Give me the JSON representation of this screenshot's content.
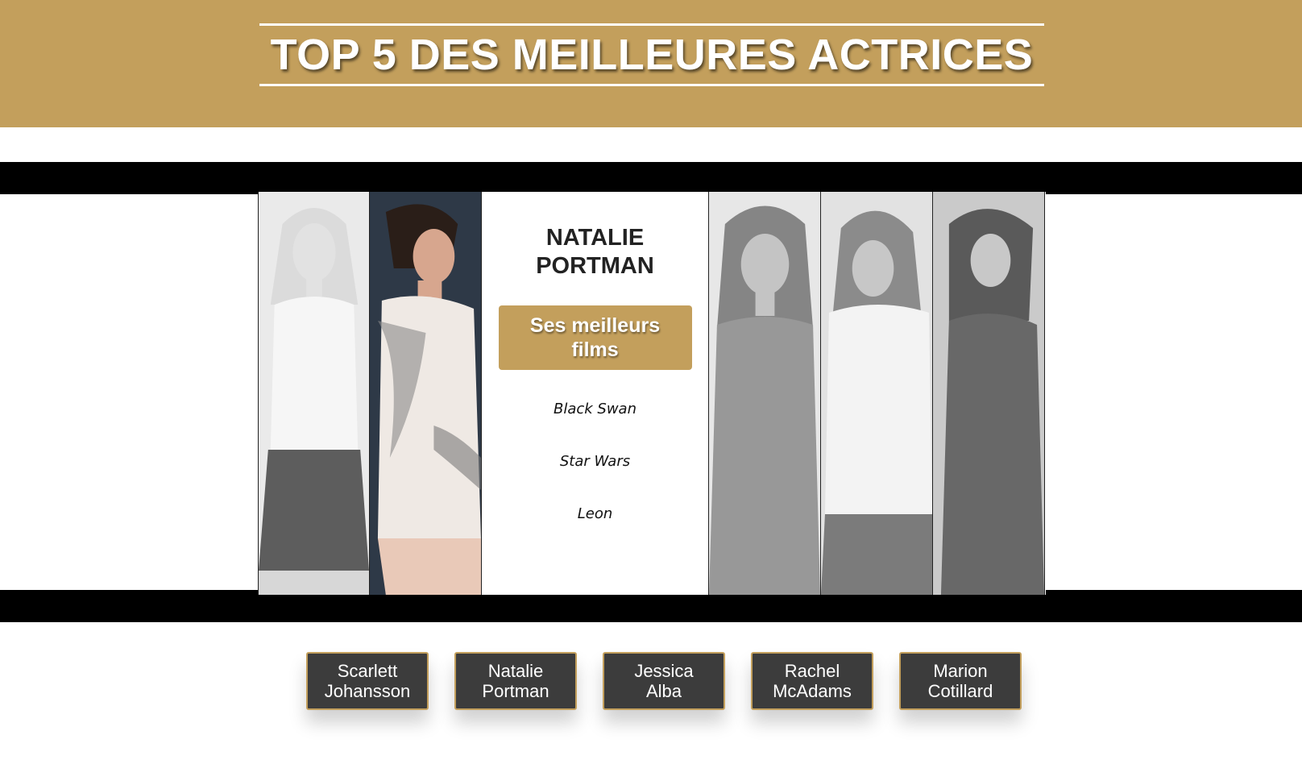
{
  "header": {
    "title": "TOP 5 DES MEILLEURES ACTRICES"
  },
  "colors": {
    "accent": "#c39f5c",
    "band": "#000000",
    "button_bg": "#3c3c3c"
  },
  "selected": {
    "name_line1": "NATALIE",
    "name_line2": "PORTMAN",
    "films_button_line1": "Ses meilleurs",
    "films_button_line2": "films",
    "films": [
      "Black Swan",
      "Star Wars",
      "Leon"
    ]
  },
  "nav": {
    "items": [
      {
        "line1": "Scarlett",
        "line2": "Johansson"
      },
      {
        "line1": "Natalie",
        "line2": "Portman"
      },
      {
        "line1": "Jessica",
        "line2": "Alba"
      },
      {
        "line1": "Rachel",
        "line2": "McAdams"
      },
      {
        "line1": "Marion",
        "line2": "Cotillard"
      }
    ]
  }
}
